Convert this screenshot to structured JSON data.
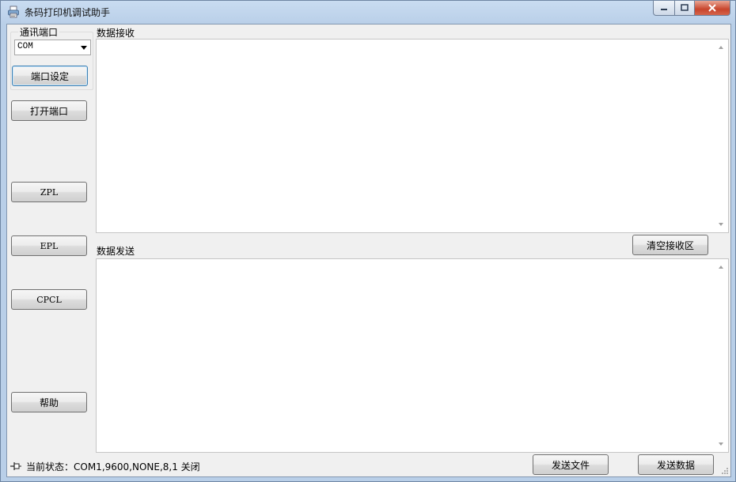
{
  "window": {
    "title": "条码打印机调试助手",
    "controls": {
      "minimize": "–",
      "maximize": "□",
      "close": "✕"
    }
  },
  "port_group": {
    "label": "通讯端口",
    "selected_port": "COM",
    "settings_button": "端口设定"
  },
  "sidebar": {
    "open_port": "打开端口",
    "zpl": "ZPL",
    "epl": "EPL",
    "cpcl": "CPCL",
    "help": "帮助"
  },
  "receive": {
    "label": "数据接收",
    "content": "",
    "clear_button": "清空接收区"
  },
  "send": {
    "label": "数据发送",
    "content": "",
    "send_file_button": "发送文件",
    "send_data_button": "发送数据"
  },
  "status": {
    "text": "当前状态：COM1,9600,NONE,8,1 关闭"
  },
  "icons": [
    "printer-app-icon",
    "pin-icon",
    "dropdown-arrow-icon",
    "scroll-up-icon",
    "scroll-down-icon",
    "resize-grip-icon"
  ]
}
